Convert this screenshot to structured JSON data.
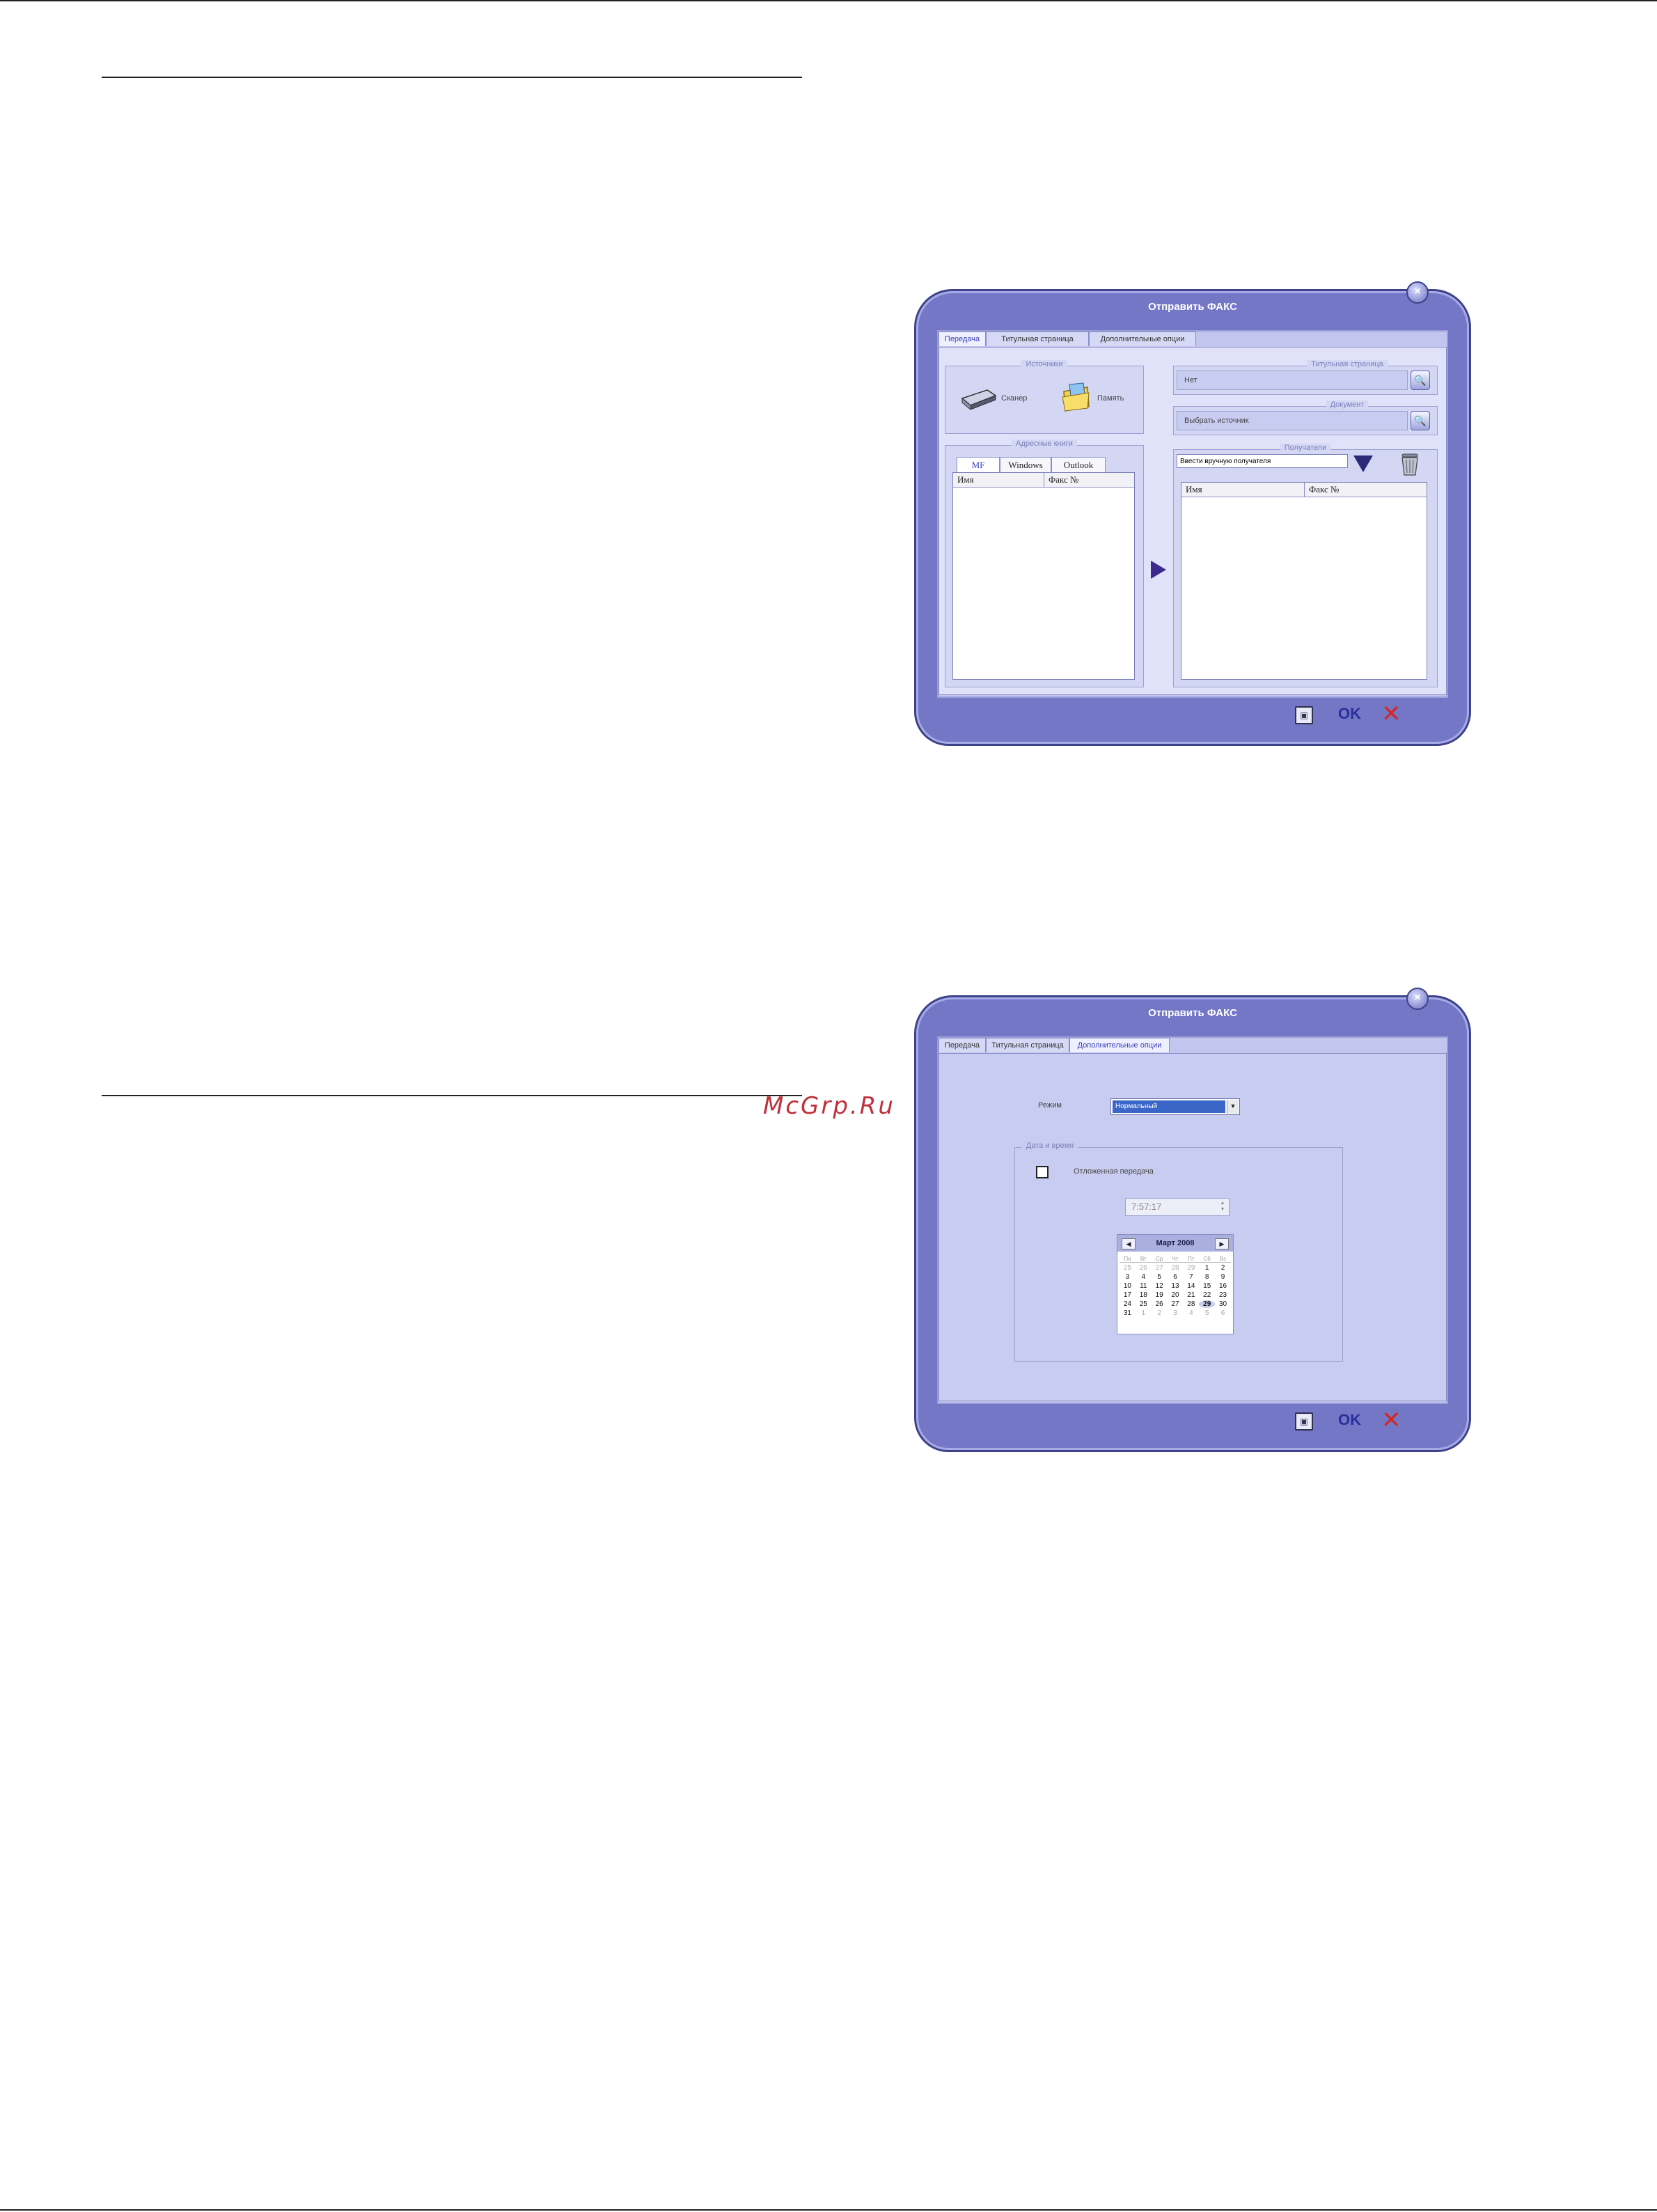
{
  "watermark": "McGrp.Ru",
  "dialog1": {
    "title": "Отправить ФАКС",
    "tabs": [
      "Передача",
      "Титульная страница",
      "Дополнительные опции"
    ],
    "source_group": "Источники",
    "scanner_label": "Сканер",
    "memory_label": "Память",
    "address_group": "Адресные книги",
    "address_tabs": [
      "MF",
      "Windows",
      "Outlook"
    ],
    "address_columns": [
      "Имя",
      "Факс №"
    ],
    "cover_group": "Титульная страница",
    "cover_value": "Нет",
    "document_group": "Документ",
    "document_value": "Выбрать источник",
    "recipients_group": "Получатели",
    "recipient_input": "Ввести вручную получателя",
    "recipient_columns": [
      "Имя",
      "Факс №"
    ],
    "footer": {
      "ok": "OK",
      "cancel": "✕"
    }
  },
  "dialog2": {
    "title": "Отправить ФАКС",
    "tabs": [
      "Передача",
      "Титульная страница",
      "Дополнительные опции"
    ],
    "mode_label": "Режим",
    "mode_value": "Нормальный",
    "datetime_group": "Дата и время",
    "deferred_label": "Отложенная передача",
    "deferred_checked": false,
    "time_value": "7:57:17",
    "calendar": {
      "month": "Март 2008",
      "dow": [
        "Пн",
        "Вт",
        "Ср",
        "Чт",
        "Пт",
        "Сб",
        "Вс"
      ],
      "days": [
        [
          "25",
          "26",
          "27",
          "28",
          "29",
          "1",
          "2"
        ],
        [
          "3",
          "4",
          "5",
          "6",
          "7",
          "8",
          "9"
        ],
        [
          "10",
          "11",
          "12",
          "13",
          "14",
          "15",
          "16"
        ],
        [
          "17",
          "18",
          "19",
          "20",
          "21",
          "22",
          "23"
        ],
        [
          "24",
          "25",
          "26",
          "27",
          "28",
          "29",
          "30"
        ],
        [
          "31",
          "1",
          "2",
          "3",
          "4",
          "5",
          "6"
        ]
      ],
      "today": "29"
    },
    "footer": {
      "ok": "OK",
      "cancel": "✕"
    }
  }
}
